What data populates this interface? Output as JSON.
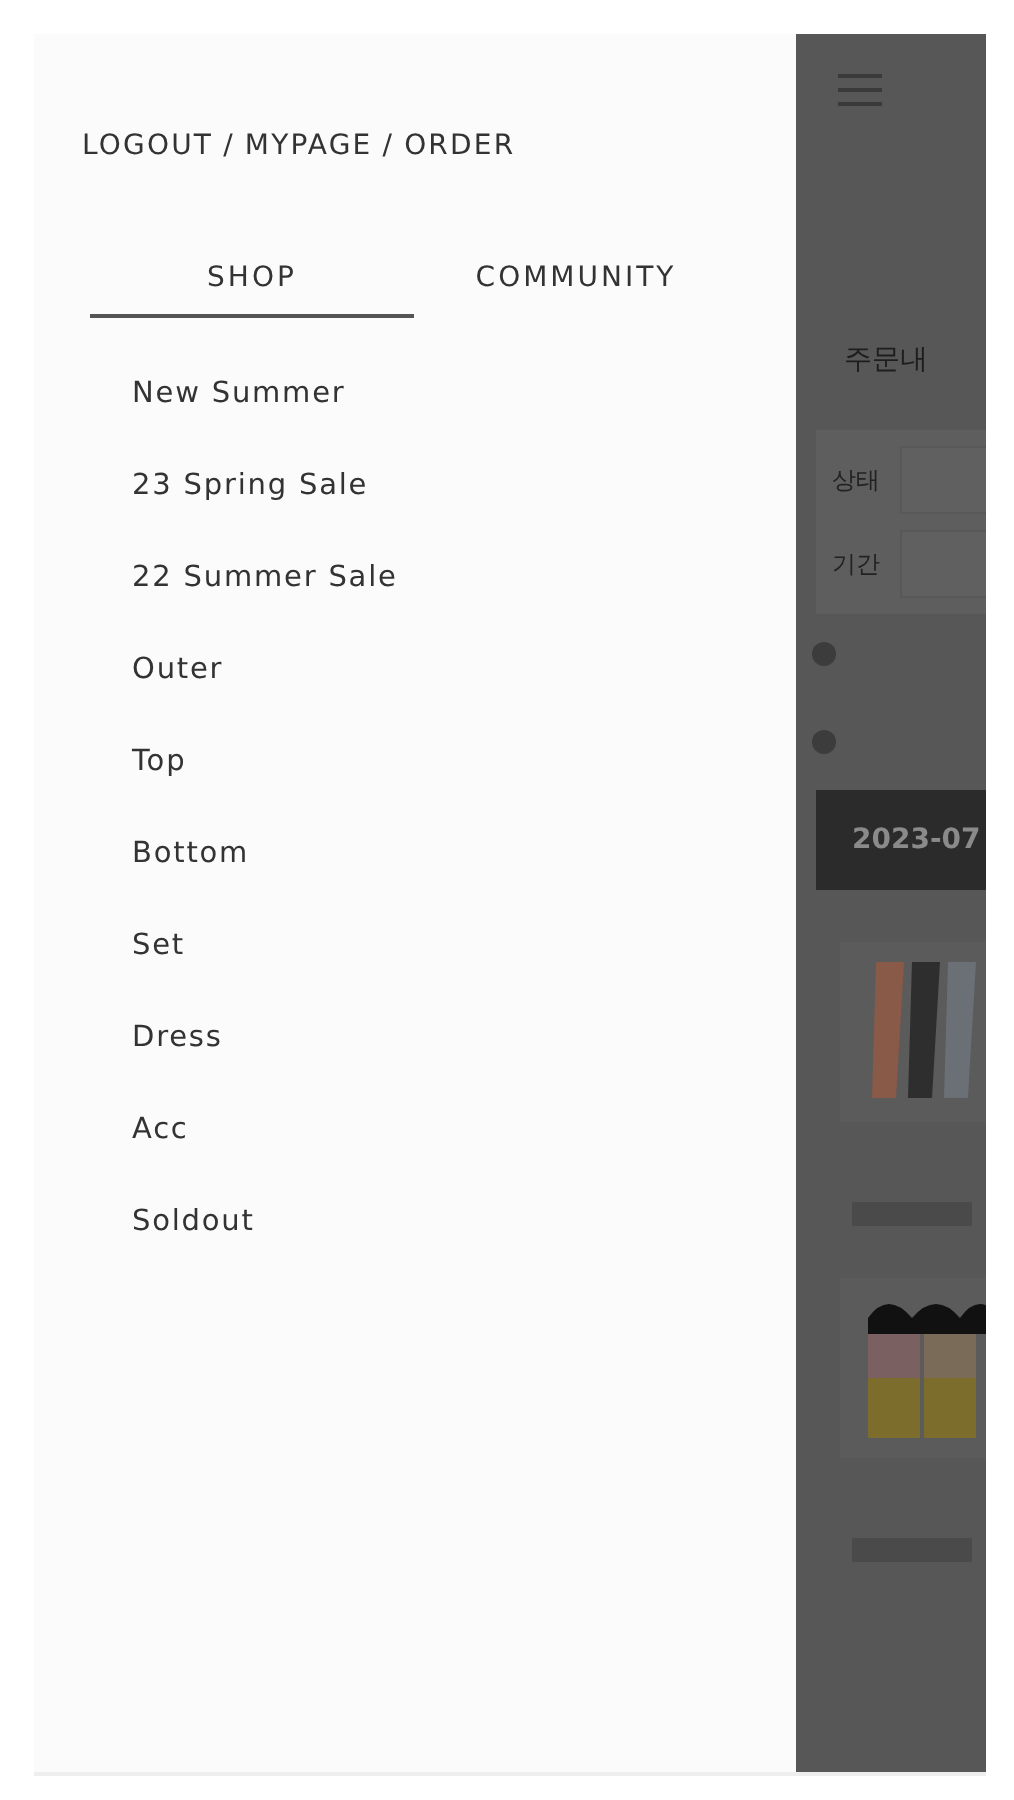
{
  "drawer": {
    "account_links": [
      {
        "label": "LOGOUT"
      },
      {
        "label": "MYPAGE"
      },
      {
        "label": "ORDER"
      }
    ],
    "separator": "/",
    "tabs": [
      {
        "label": "SHOP",
        "selected": true
      },
      {
        "label": "COMMUNITY",
        "selected": false
      }
    ],
    "menu": [
      {
        "label": "New Summer"
      },
      {
        "label": "23 Spring Sale"
      },
      {
        "label": "22 Summer Sale"
      },
      {
        "label": "Outer"
      },
      {
        "label": "Top"
      },
      {
        "label": "Bottom"
      },
      {
        "label": "Set"
      },
      {
        "label": "Dress"
      },
      {
        "label": "Acc"
      },
      {
        "label": "Soldout"
      }
    ]
  },
  "background_page": {
    "title": "주문내",
    "filters": [
      {
        "label": "상태"
      },
      {
        "label": "기간"
      }
    ],
    "date_bar": "2023-07"
  }
}
